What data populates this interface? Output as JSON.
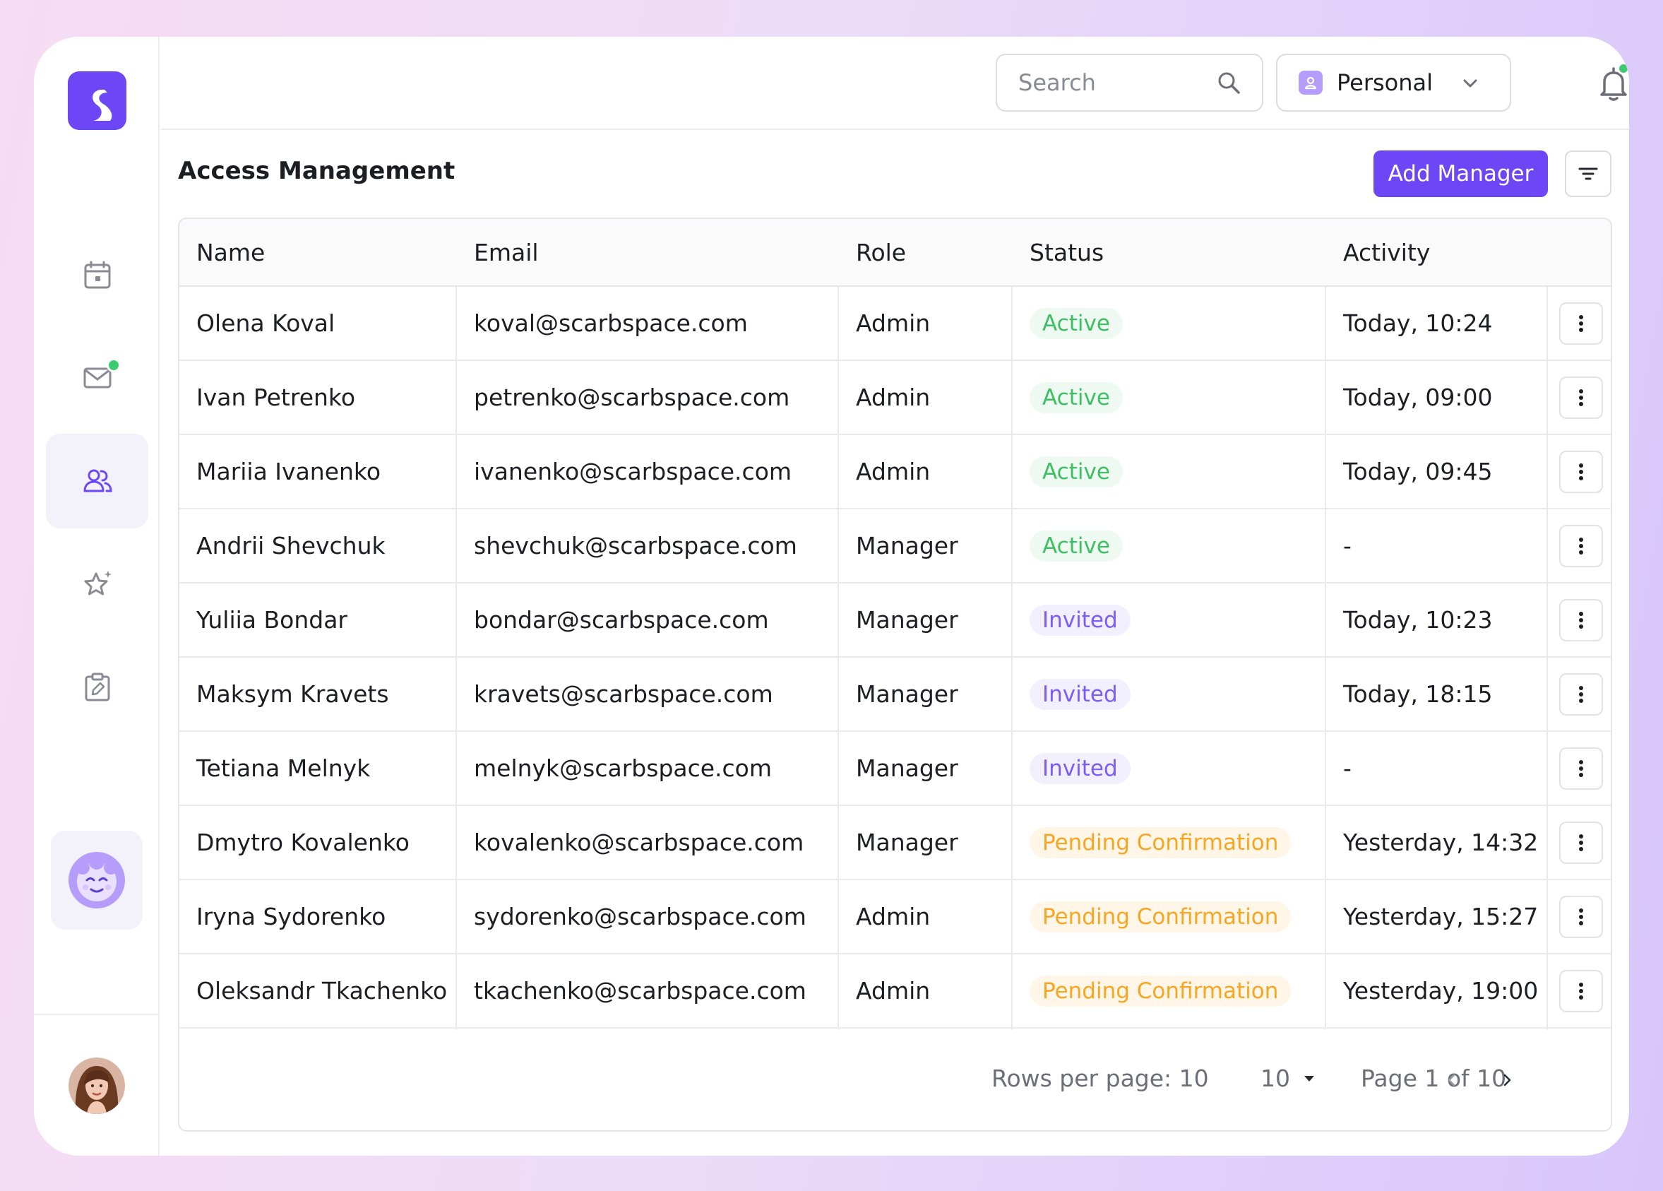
{
  "topbar": {
    "search_placeholder": "Search",
    "workspace_label": "Personal"
  },
  "page": {
    "title": "Access Management",
    "add_button": "Add Manager"
  },
  "table": {
    "headers": {
      "name": "Name",
      "email": "Email",
      "role": "Role",
      "status": "Status",
      "activity": "Activity"
    },
    "rows": [
      {
        "name": "Olena Koval",
        "email": "koval@scarbspace.com",
        "role": "Admin",
        "status": "Active",
        "activity": "Today, 10:24"
      },
      {
        "name": "Ivan Petrenko",
        "email": "petrenko@scarbspace.com",
        "role": "Admin",
        "status": "Active",
        "activity": "Today, 09:00"
      },
      {
        "name": "Mariia Ivanenko",
        "email": "ivanenko@scarbspace.com",
        "role": "Admin",
        "status": "Active",
        "activity": "Today, 09:45"
      },
      {
        "name": "Andrii Shevchuk",
        "email": "shevchuk@scarbspace.com",
        "role": "Manager",
        "status": "Active",
        "activity": "-"
      },
      {
        "name": "Yuliia Bondar",
        "email": "bondar@scarbspace.com",
        "role": "Manager",
        "status": "Invited",
        "activity": "Today, 10:23"
      },
      {
        "name": "Maksym Kravets",
        "email": "kravets@scarbspace.com",
        "role": "Manager",
        "status": "Invited",
        "activity": "Today, 18:15"
      },
      {
        "name": "Tetiana Melnyk",
        "email": "melnyk@scarbspace.com",
        "role": "Manager",
        "status": "Invited",
        "activity": "-"
      },
      {
        "name": "Dmytro Kovalenko",
        "email": "kovalenko@scarbspace.com",
        "role": "Manager",
        "status": "Pending Confirmation",
        "activity": "Yesterday, 14:32"
      },
      {
        "name": "Iryna Sydorenko",
        "email": "sydorenko@scarbspace.com",
        "role": "Admin",
        "status": "Pending Confirmation",
        "activity": "Yesterday, 15:27"
      },
      {
        "name": "Oleksandr Tkachenko",
        "email": "tkachenko@scarbspace.com",
        "role": "Admin",
        "status": "Pending Confirmation",
        "activity": "Yesterday, 19:00"
      }
    ]
  },
  "pagination": {
    "rows_per_page_label": "Rows per page: 10",
    "rows_per_page_value": "10",
    "page_label": "Page 1 of 10"
  },
  "status_colors": {
    "Active": {
      "text": "#3fbf63",
      "bg": "#eef9f1"
    },
    "Invited": {
      "text": "#7c5cf4",
      "bg": "#f2efff"
    },
    "Pending Confirmation": {
      "text": "#f5a623",
      "bg": "#fff6e8"
    }
  },
  "colors": {
    "accent": "#6d47f5",
    "notification_dot": "#3ccb6e"
  },
  "sidebar": {
    "items": [
      {
        "icon": "calendar-icon"
      },
      {
        "icon": "mail-icon"
      },
      {
        "icon": "users-icon",
        "active": true
      },
      {
        "icon": "star-icon"
      },
      {
        "icon": "clipboard-edit-icon"
      }
    ]
  }
}
